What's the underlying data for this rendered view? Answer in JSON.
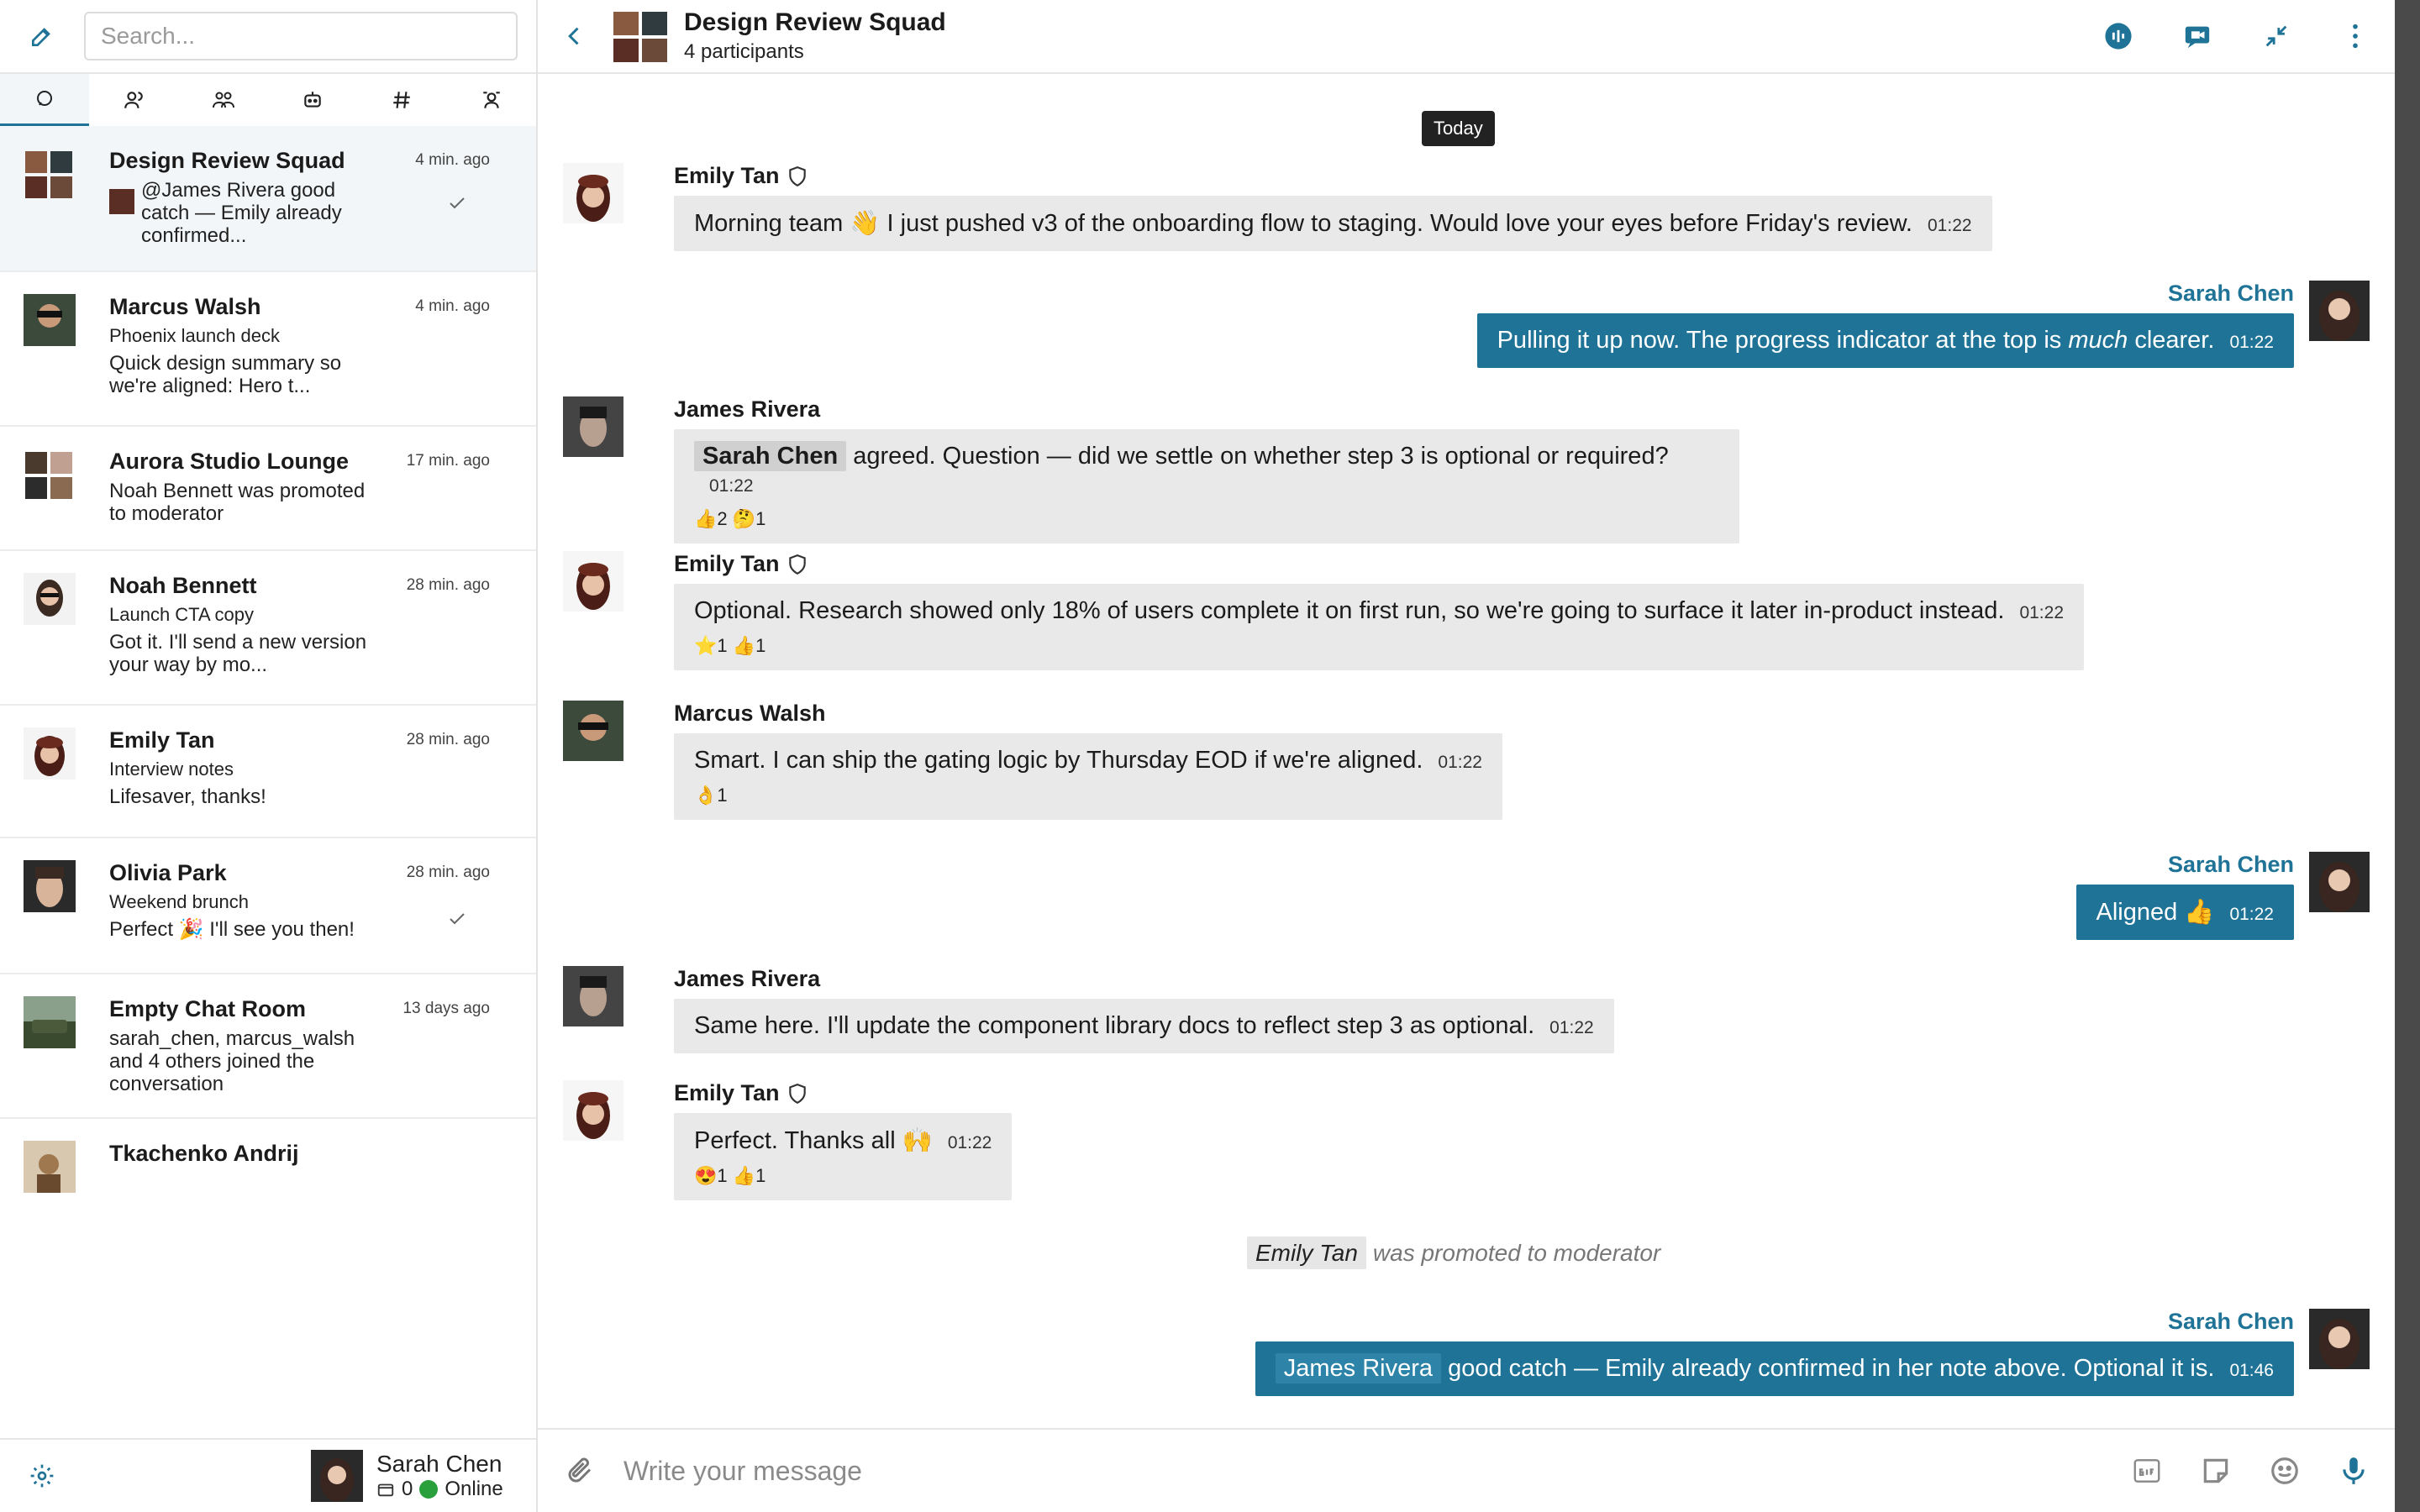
{
  "sidebar": {
    "search_placeholder": "Search...",
    "conversations": [
      {
        "name": "Design Review Squad",
        "time": "4 min. ago",
        "preview": "@James Rivera good catch — Emily already confirmed...",
        "checked": true
      },
      {
        "name": "Marcus Walsh",
        "time": "4 min. ago",
        "subtitle": "Phoenix launch deck",
        "preview": "Quick design summary so we're aligned: Hero t..."
      },
      {
        "name": "Aurora Studio Lounge",
        "time": "17 min. ago",
        "preview": "Noah Bennett was promoted to moderator"
      },
      {
        "name": "Noah Bennett",
        "time": "28 min. ago",
        "subtitle": "Launch CTA copy",
        "preview": "Got it. I'll send a new version your way by mo..."
      },
      {
        "name": "Emily Tan",
        "time": "28 min. ago",
        "subtitle": "Interview notes",
        "preview": "Lifesaver, thanks!"
      },
      {
        "name": "Olivia Park",
        "time": "28 min. ago",
        "subtitle": "Weekend brunch",
        "preview": "Perfect 🎉 I'll see you then!",
        "checked": true
      },
      {
        "name": "Empty Chat Room",
        "time": "13 days ago",
        "preview": "sarah_chen, marcus_walsh and 4 others joined the conversation"
      },
      {
        "name": "Tkachenko Andrij",
        "time": "",
        "preview": ""
      }
    ],
    "me": {
      "name": "Sarah Chen",
      "count": "0",
      "status": "Online"
    }
  },
  "header": {
    "title": "Design Review Squad",
    "subtitle": "4 participants"
  },
  "chat": {
    "day_label": "Today",
    "messages": [
      {
        "sender": "Emily Tan",
        "text": "Morning team 👋 I just pushed v3 of the onboarding flow to staging. Would love your eyes before Friday's review.",
        "time": "01:22"
      },
      {
        "sender": "Sarah Chen",
        "text_before": "Pulling it up now. The progress indicator at the top is ",
        "text_em": "much",
        "text_after": " clearer.",
        "time": "01:22"
      },
      {
        "sender": "James Rivera",
        "mention": "Sarah Chen",
        "text": " agreed. Question — did we settle on whether step 3 is optional or required?",
        "time": "01:22",
        "reactions": "👍2 🤔1"
      },
      {
        "sender": "Emily Tan",
        "text": "Optional. Research showed only 18% of users complete it on first run, so we're going to surface it later in-product instead.",
        "time": "01:22",
        "reactions": "⭐1 👍1"
      },
      {
        "sender": "Marcus Walsh",
        "text": "Smart. I can ship the gating logic by Thursday EOD if we're aligned.",
        "time": "01:22",
        "reactions": "👌1"
      },
      {
        "sender": "Sarah Chen",
        "text": "Aligned 👍",
        "time": "01:22"
      },
      {
        "sender": "James Rivera",
        "text": "Same here. I'll update the component library docs to reflect step 3 as optional.",
        "time": "01:22"
      },
      {
        "sender": "Emily Tan",
        "text": "Perfect. Thanks all 🙌",
        "time": "01:22",
        "reactions": "😍1 👍1"
      },
      {
        "sender": "Sarah Chen",
        "mention": "James Rivera",
        "text": " good catch — Emily already confirmed in her note above. Optional it is.",
        "time": "01:46"
      }
    ],
    "system": {
      "name": "Emily Tan",
      "text": "was promoted to moderator"
    }
  },
  "composer": {
    "placeholder": "Write your message"
  },
  "colors": {
    "accent": "#1f7396",
    "bubble": "#e9e9e9",
    "online": "#2aa03c"
  }
}
